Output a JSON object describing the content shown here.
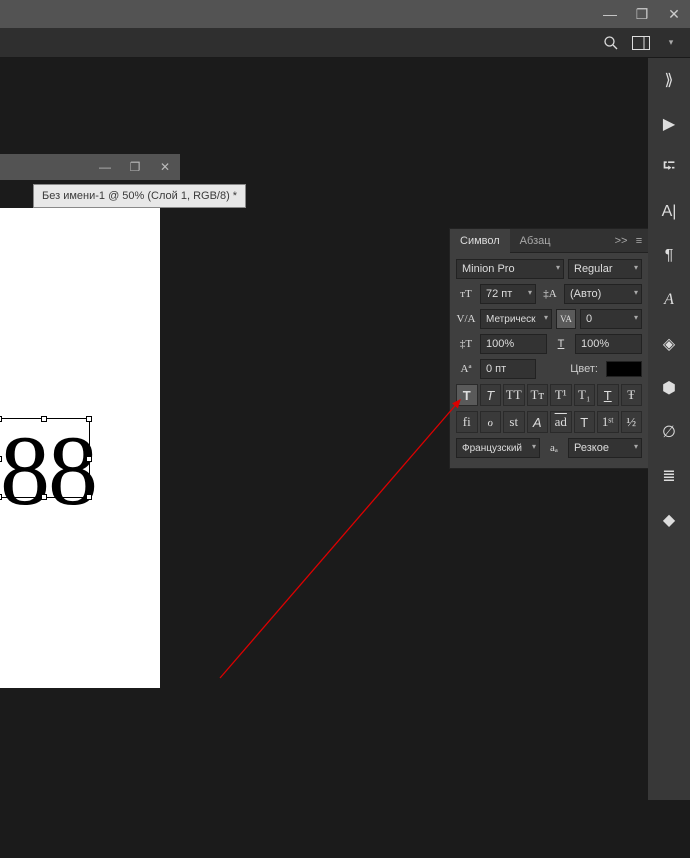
{
  "window_controls": {
    "min": "—",
    "max": "❐",
    "close": "✕"
  },
  "topbar": {
    "search": "search",
    "layout": "layout",
    "more": "more"
  },
  "document": {
    "tab_label": "Без имени-1 @ 50% (Слой 1, RGB/8) *",
    "text": "88"
  },
  "char_panel": {
    "tabs": {
      "character": "Символ",
      "paragraph": "Абзац",
      "collapse": ">>",
      "menu": "≡"
    },
    "font_family": "Minion Pro",
    "font_style": "Regular",
    "size": "72 пт",
    "leading": "(Авто)",
    "kerning": "Метрическ",
    "tracking": "0",
    "vscale": "100%",
    "hscale": "100%",
    "baseline": "0 пт",
    "color_label": "Цвет:",
    "lang": "Французский",
    "aa_icon": "aₐ",
    "aa": "Резкое",
    "faux_bold": "T",
    "faux_italic": "T",
    "allcaps": "TT",
    "smallcaps": "Tᴛ",
    "super": "T¹",
    "sub": "T₁",
    "underline": "T",
    "strike": "Ŧ",
    "lig": "fi",
    "dlig": "ℴ",
    "swash": "st",
    "titling": "A",
    "ord": "ad",
    "frac": "½",
    "stylistic": "1ˢᵗ",
    "just": "T"
  },
  "rtools": [
    "⟫",
    "▶",
    "⮓",
    "A|",
    "¶",
    "A",
    "◈",
    "⬢",
    "∅",
    "≣",
    "◆"
  ]
}
